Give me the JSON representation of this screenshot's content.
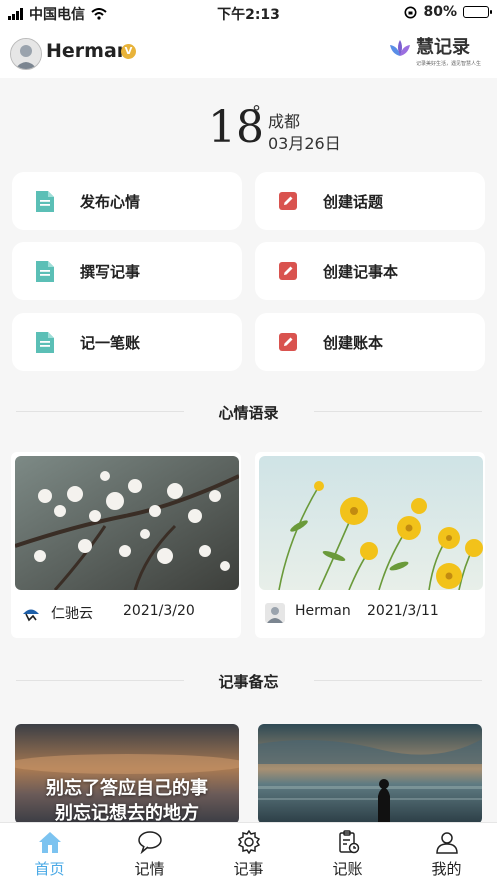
{
  "status_bar": {
    "carrier": "中国电信",
    "time": "下午2:13",
    "battery": "80%",
    "battery_level": 0.8
  },
  "header": {
    "username": "Herman",
    "badge": "V",
    "logo_name": "慧记录",
    "logo_slogan": "记录美好生活，遇见智慧人生"
  },
  "weather": {
    "temperature": "18",
    "degree": "°",
    "city": "成都",
    "date": "03月26日"
  },
  "actions": [
    {
      "label": "发布心情",
      "icon": "document-icon",
      "color": "#5bbfb6"
    },
    {
      "label": "创建话题",
      "icon": "edit-icon",
      "color": "#d9534f"
    },
    {
      "label": "撰写记事",
      "icon": "document-icon",
      "color": "#5bbfb6"
    },
    {
      "label": "创建记事本",
      "icon": "edit-icon",
      "color": "#d9534f"
    },
    {
      "label": "记一笔账",
      "icon": "document-icon",
      "color": "#5bbfb6"
    },
    {
      "label": "创建账本",
      "icon": "edit-icon",
      "color": "#d9534f"
    }
  ],
  "sections": {
    "mood_quotes": "心情语录",
    "memos": "记事备忘"
  },
  "mood_cards": [
    {
      "author": "仁驰云",
      "date": "2021/3/20",
      "image": "blossom-photo"
    },
    {
      "author": "Herman",
      "date": "2021/3/11",
      "image": "yellow-flowers-photo"
    }
  ],
  "memo_cards": [
    {
      "line1": "别忘了答应自己的事",
      "line2": "别忘记想去的地方",
      "image": "sunset-photo"
    },
    {
      "image": "beach-silhouette-photo"
    }
  ],
  "tabs": [
    {
      "label": "首页",
      "icon": "home-icon",
      "active": true
    },
    {
      "label": "记情",
      "icon": "chat-bubble-icon",
      "active": false
    },
    {
      "label": "记事",
      "icon": "gear-icon",
      "active": false
    },
    {
      "label": "记账",
      "icon": "clipboard-clock-icon",
      "active": false
    },
    {
      "label": "我的",
      "icon": "person-icon",
      "active": false
    }
  ],
  "colors": {
    "accent": "#4aa9e6",
    "teal_icon": "#5bbfb6",
    "red_icon": "#d9534f",
    "badge": "#e8b33a"
  }
}
